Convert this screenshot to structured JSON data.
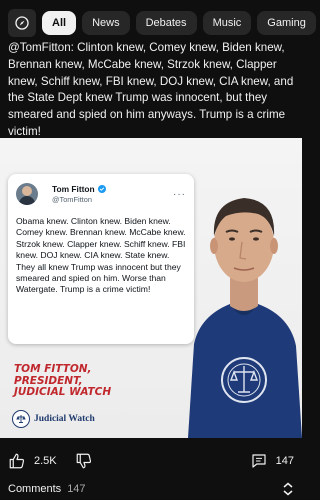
{
  "chips": [
    "All",
    "News",
    "Debates",
    "Music",
    "Gaming"
  ],
  "post_text": "@TomFitton: Clinton knew, Comey knew, Biden knew, Brennan knew, McCabe knew, Strzok knew, Clapper knew, Schiff knew, FBI knew, DOJ knew, CIA knew, and the State Dept knew Trump was innocent, but they smeared and spied on him anyways. Trump is a crime victim!",
  "tweet": {
    "name": "Tom Fitton",
    "handle": "@TomFitton",
    "more": "···",
    "body": "Obama knew. Clinton knew. Biden knew. Comey knew. Brennan knew. McCabe knew. Strzok knew. Clapper knew. Schiff knew. FBI knew. DOJ knew. CIA knew. State knew. They all knew Trump was innocent but they smeared and spied on him. Worse than Watergate.  Trump is a crime victim!"
  },
  "caption": {
    "line1": "Tom Fitton,",
    "line2": "President,",
    "line3": "Judicial Watch"
  },
  "logo_text": "Judicial Watch",
  "actions": {
    "likes": "2.5K",
    "comments_count": "147"
  },
  "comments": {
    "label": "Comments",
    "count": "147"
  },
  "colors": {
    "background": "#0f0f0f",
    "chip_bg": "#272727",
    "chip_active_bg": "#f1f1f1",
    "caption_red": "#c0282d",
    "verified_blue": "#1d9bf0"
  }
}
